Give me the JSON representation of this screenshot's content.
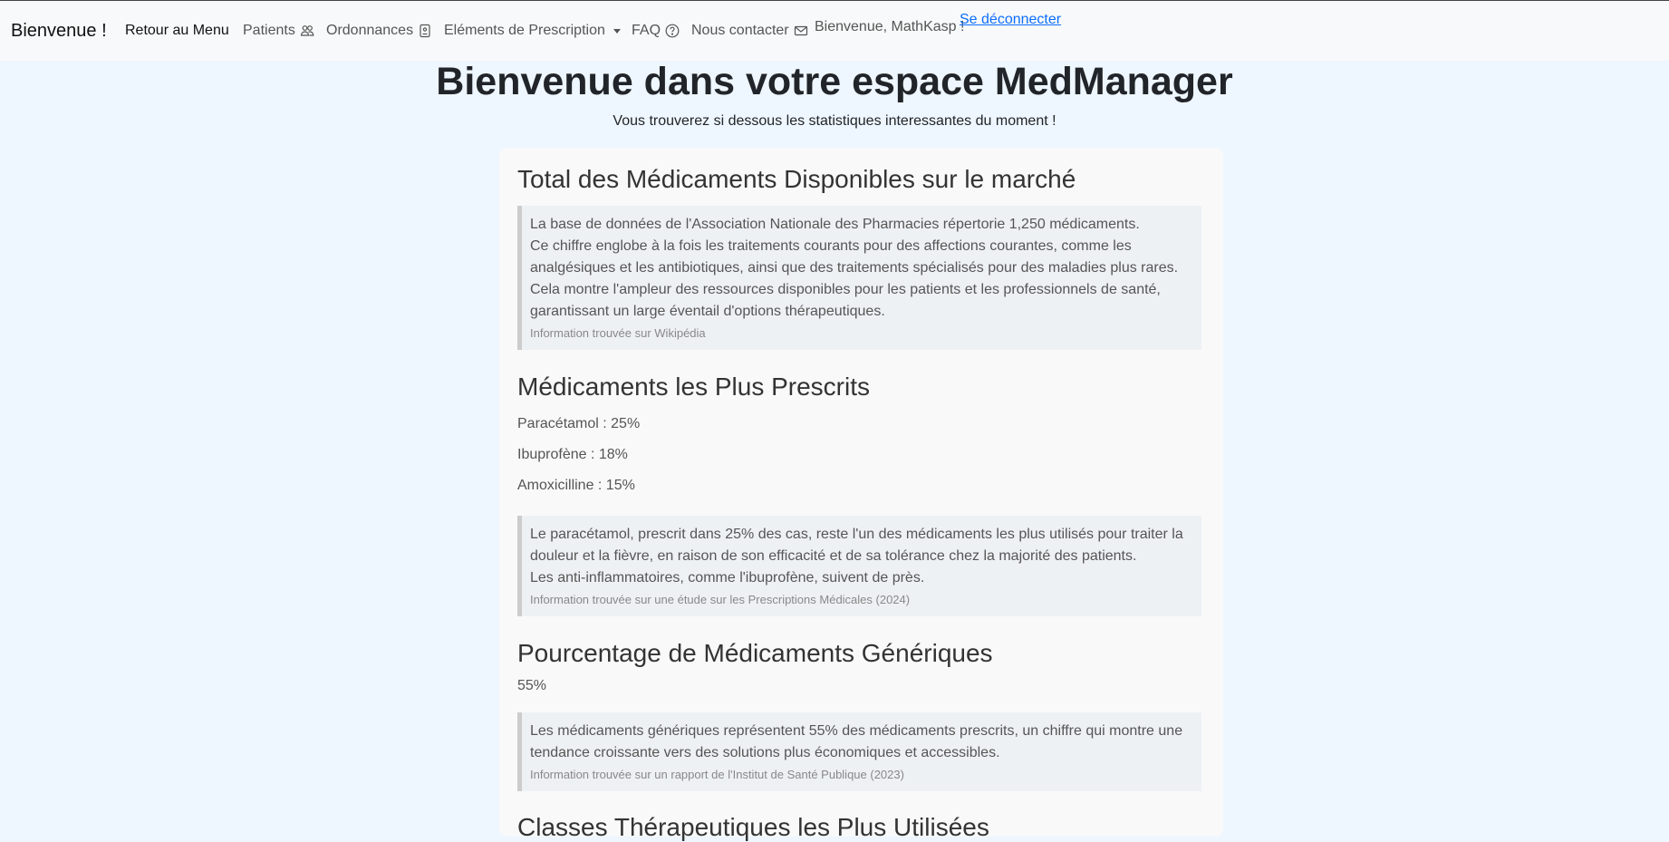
{
  "nav": {
    "brand": "Bienvenue !",
    "items": [
      {
        "label": "Retour au Menu"
      },
      {
        "label": "Patients",
        "icon": "people-icon"
      },
      {
        "label": "Ordonnances",
        "icon": "document-icon"
      },
      {
        "label": "Eléments de Prescription",
        "icon": "chevron-down-icon"
      },
      {
        "label": "FAQ",
        "icon": "question-circle-icon"
      },
      {
        "label": "Nous contacter",
        "icon": "envelope-icon"
      }
    ],
    "welcome": "Bienvenue, MathKasp !",
    "logout": "Se déconnecter"
  },
  "header": {
    "title": "Bienvenue dans votre espace MedManager",
    "subtitle": "Vous trouverez si dessous les statistiques interessantes du moment !"
  },
  "sections": {
    "total": {
      "title": "Total des Médicaments Disponibles sur le marché",
      "lines": [
        "La base de données de l'Association Nationale des Pharmacies répertorie 1,250 médicaments.",
        "Ce chiffre englobe à la fois les traitements courants pour des affections courantes, comme les analgésiques et les antibiotiques, ainsi que des traitements spécialisés pour des maladies plus rares.",
        "Cela montre l'ampleur des ressources disponibles pour les patients et les professionnels de santé, garantissant un large éventail d'options thérapeutiques."
      ],
      "source": "Information trouvée sur Wikipédia"
    },
    "prescribed": {
      "title": "Médicaments les Plus Prescrits",
      "items": [
        "Paracétamol : 25%",
        "Ibuprofène : 18%",
        "Amoxicilline : 15%"
      ],
      "lines": [
        "Le paracétamol, prescrit dans 25% des cas, reste l'un des médicaments les plus utilisés pour traiter la douleur et la fièvre, en raison de son efficacité et de sa tolérance chez la majorité des patients.",
        "Les anti-inflammatoires, comme l'ibuprofène, suivent de près."
      ],
      "source": "Information trouvée sur une étude sur les Prescriptions Médicales (2024)"
    },
    "generics": {
      "title": "Pourcentage de Médicaments Génériques",
      "value": "55%",
      "lines": [
        "Les médicaments génériques représentent 55% des médicaments prescrits, un chiffre qui montre une tendance croissante vers des solutions plus économiques et accessibles."
      ],
      "source": "Information trouvée sur un rapport de l'Institut de Santé Publique (2023)"
    },
    "classes": {
      "title": "Classes Thérapeutiques les Plus Utilisées"
    }
  }
}
